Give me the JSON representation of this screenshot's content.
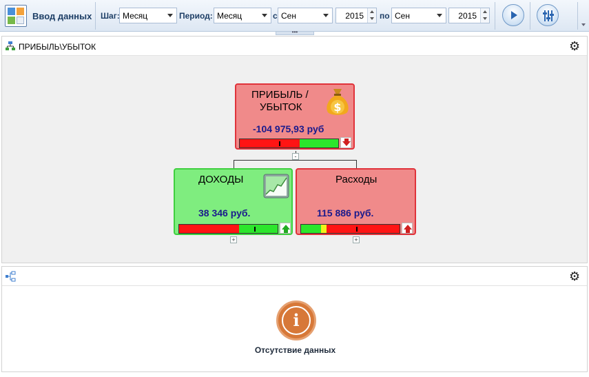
{
  "toolbar": {
    "data_entry_label": "Ввод данных",
    "step_label": "Шаг:",
    "step_value": "Месяц",
    "period_label": "Период:",
    "period_value": "Месяц",
    "from_label": "с",
    "from_month": "Сен",
    "from_year": "2015",
    "to_label": "по",
    "to_month": "Сен",
    "to_year": "2015",
    "splitter_grip": "•••"
  },
  "top_panel": {
    "title": "ПРИБЫЛЬ\\УБЫТОК",
    "cards": {
      "profit": {
        "title_line1": "ПРИБЫЛЬ /",
        "title_line2": "УБЫТОК",
        "value": "-104 975,93 руб",
        "trend": "down",
        "bar": {
          "red_fraction": 0.62,
          "green_fraction": 0.38,
          "marker_fraction": 0.41
        },
        "collapse_label": "-"
      },
      "income": {
        "title": "ДОХОДЫ",
        "value": "38 346 руб.",
        "trend": "up",
        "bar": {
          "red_fraction": 0.61,
          "green_fraction": 0.39,
          "marker_fraction": 0.77
        },
        "expand_label": "+"
      },
      "expenses": {
        "title": "Расходы",
        "value": "115 886 руб.",
        "trend": "up",
        "bar": {
          "green_fraction": 0.2,
          "yellow_fraction": 0.06,
          "marker_fraction": 0.57
        },
        "expand_label": "+"
      }
    },
    "colors": {
      "card_red": "#f08a8a",
      "card_green": "#7fed7f",
      "value_text": "#1a1a8c"
    }
  },
  "bottom_panel": {
    "title": "",
    "no_data_text": "Отсутствие данных",
    "info_glyph": "i"
  }
}
